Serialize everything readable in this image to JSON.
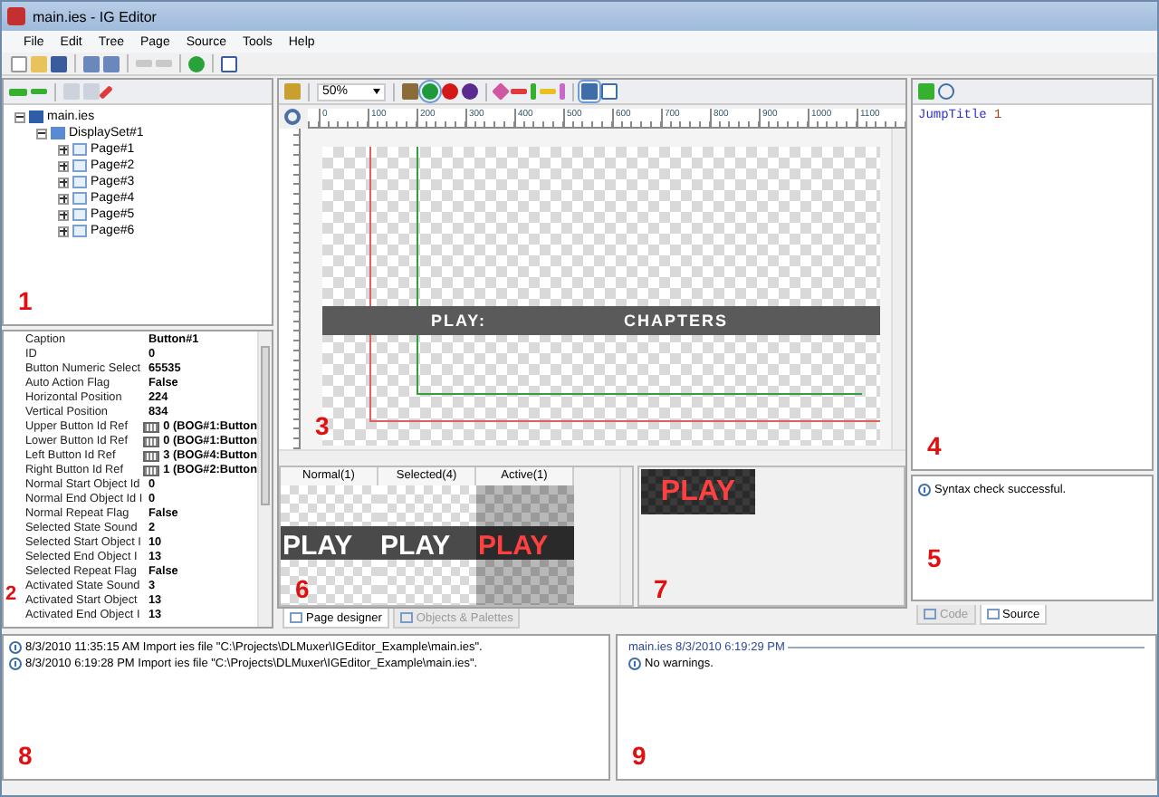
{
  "window": {
    "title": "main.ies - IG Editor"
  },
  "menu": [
    "File",
    "Edit",
    "Tree",
    "Page",
    "Source",
    "Tools",
    "Help"
  ],
  "tree": [
    {
      "label": "main.ies",
      "kind": "file",
      "expanded": true,
      "children": [
        {
          "label": "DisplaySet#1",
          "kind": "set",
          "expanded": true,
          "children": [
            {
              "label": "Page#1",
              "kind": "page",
              "expanded": false
            },
            {
              "label": "Page#2",
              "kind": "page",
              "expanded": false
            },
            {
              "label": "Page#3",
              "kind": "page",
              "expanded": false
            },
            {
              "label": "Page#4",
              "kind": "page",
              "expanded": false
            },
            {
              "label": "Page#5",
              "kind": "page",
              "expanded": false
            },
            {
              "label": "Page#6",
              "kind": "page",
              "expanded": false
            }
          ]
        }
      ]
    }
  ],
  "properties": [
    {
      "name": "Caption",
      "value": "Button#1",
      "kind": "text"
    },
    {
      "name": "ID",
      "value": "0",
      "kind": "text"
    },
    {
      "name": "Button Numeric Select",
      "value": "65535",
      "kind": "text"
    },
    {
      "name": "Auto Action Flag",
      "value": "False",
      "kind": "text"
    },
    {
      "name": "Horizontal Position",
      "value": "224",
      "kind": "text"
    },
    {
      "name": "Vertical Position",
      "value": "834",
      "kind": "text"
    },
    {
      "name": "Upper Button Id Ref",
      "value": "0 (BOG#1:Button",
      "kind": "ref"
    },
    {
      "name": "Lower Button Id Ref",
      "value": "0 (BOG#1:Button",
      "kind": "ref"
    },
    {
      "name": "Left Button Id Ref",
      "value": "3 (BOG#4:Button",
      "kind": "ref"
    },
    {
      "name": "Right Button Id Ref",
      "value": "1 (BOG#2:Button",
      "kind": "ref"
    },
    {
      "name": "Normal Start Object Id",
      "value": "0",
      "kind": "text"
    },
    {
      "name": "Normal End Object Id I",
      "value": "0",
      "kind": "text"
    },
    {
      "name": "Normal Repeat Flag",
      "value": "False",
      "kind": "text"
    },
    {
      "name": "Selected State Sound",
      "value": "2",
      "kind": "text"
    },
    {
      "name": "Selected Start Object I",
      "value": "10",
      "kind": "text"
    },
    {
      "name": "Selected End Object I",
      "value": "13",
      "kind": "text"
    },
    {
      "name": "Selected Repeat Flag",
      "value": "False",
      "kind": "text"
    },
    {
      "name": "Activated State Sound",
      "value": "3",
      "kind": "text"
    },
    {
      "name": "Activated Start Object",
      "value": "13",
      "kind": "text"
    },
    {
      "name": "Activated End Object I",
      "value": "13",
      "kind": "text"
    }
  ],
  "designer": {
    "zoom": "50%",
    "ruler": [
      "0",
      "100",
      "200",
      "300",
      "400",
      "500",
      "600",
      "700",
      "800",
      "900",
      "1000",
      "1100"
    ],
    "canvas_texts": [
      "PLAY:",
      "CHAPTERS"
    ]
  },
  "states": {
    "columns": [
      "Normal(1)",
      "Selected(4)",
      "Active(1)"
    ],
    "images": [
      {
        "text": "PLAY",
        "kind": "normal"
      },
      {
        "text": "PLAY",
        "kind": "selected"
      },
      {
        "text": "PLAY",
        "kind": "active"
      }
    ]
  },
  "preview": {
    "text": "PLAY"
  },
  "designer_tabs": [
    {
      "label": "Page designer",
      "selected": true
    },
    {
      "label": "Objects & Palettes",
      "selected": false
    }
  ],
  "code": [
    {
      "keyword": "JumpTitle",
      "argument": "1"
    }
  ],
  "syntax": {
    "message": "Syntax check successful."
  },
  "source_tabs": [
    {
      "label": "Code",
      "selected": false
    },
    {
      "label": "Source",
      "selected": true
    }
  ],
  "log": [
    "8/3/2010 11:35:15 AM Import ies file \"C:\\Projects\\DLMuxer\\IGEditor_Example\\main.ies\".",
    "8/3/2010 6:19:28 PM Import ies file \"C:\\Projects\\DLMuxer\\IGEditor_Example\\main.ies\"."
  ],
  "messages": {
    "header": "main.ies 8/3/2010 6:19:29 PM",
    "items": [
      "No warnings."
    ]
  },
  "annotations": [
    "1",
    "2",
    "3",
    "4",
    "5",
    "6",
    "7",
    "8",
    "9"
  ]
}
